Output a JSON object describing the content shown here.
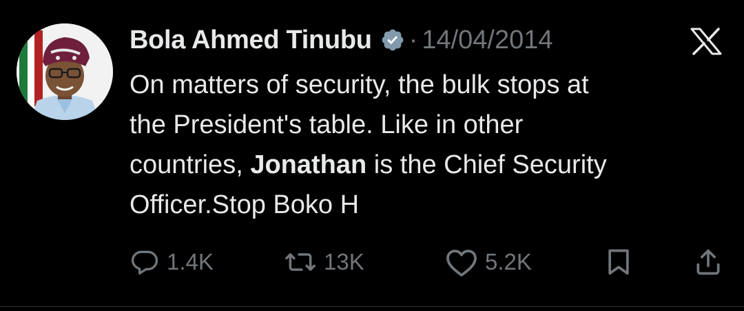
{
  "author": {
    "name": "Bola Ahmed Tinubu",
    "verified": true,
    "verified_color": "#829aab"
  },
  "separator": "·",
  "date": "14/04/2014",
  "post": {
    "line1": "On matters of security, the bulk stops at",
    "line2": "the President's table. Like in other",
    "line3_pre": "countries, ",
    "line3_bold": "Jonathan",
    "line3_post": " is the Chief Security",
    "line4": "Officer.Stop Boko H"
  },
  "actions": {
    "replies": "1.4K",
    "reposts": "13K",
    "likes": "5.2K"
  },
  "icons": {
    "platform": "x-logo-icon",
    "reply": "speech-bubble-icon",
    "repost": "repost-arrows-icon",
    "like": "heart-icon",
    "bookmark": "bookmark-icon",
    "share": "share-upload-icon"
  },
  "colors": {
    "background": "#000000",
    "text": "#e7e9ea",
    "muted": "#71767b"
  }
}
